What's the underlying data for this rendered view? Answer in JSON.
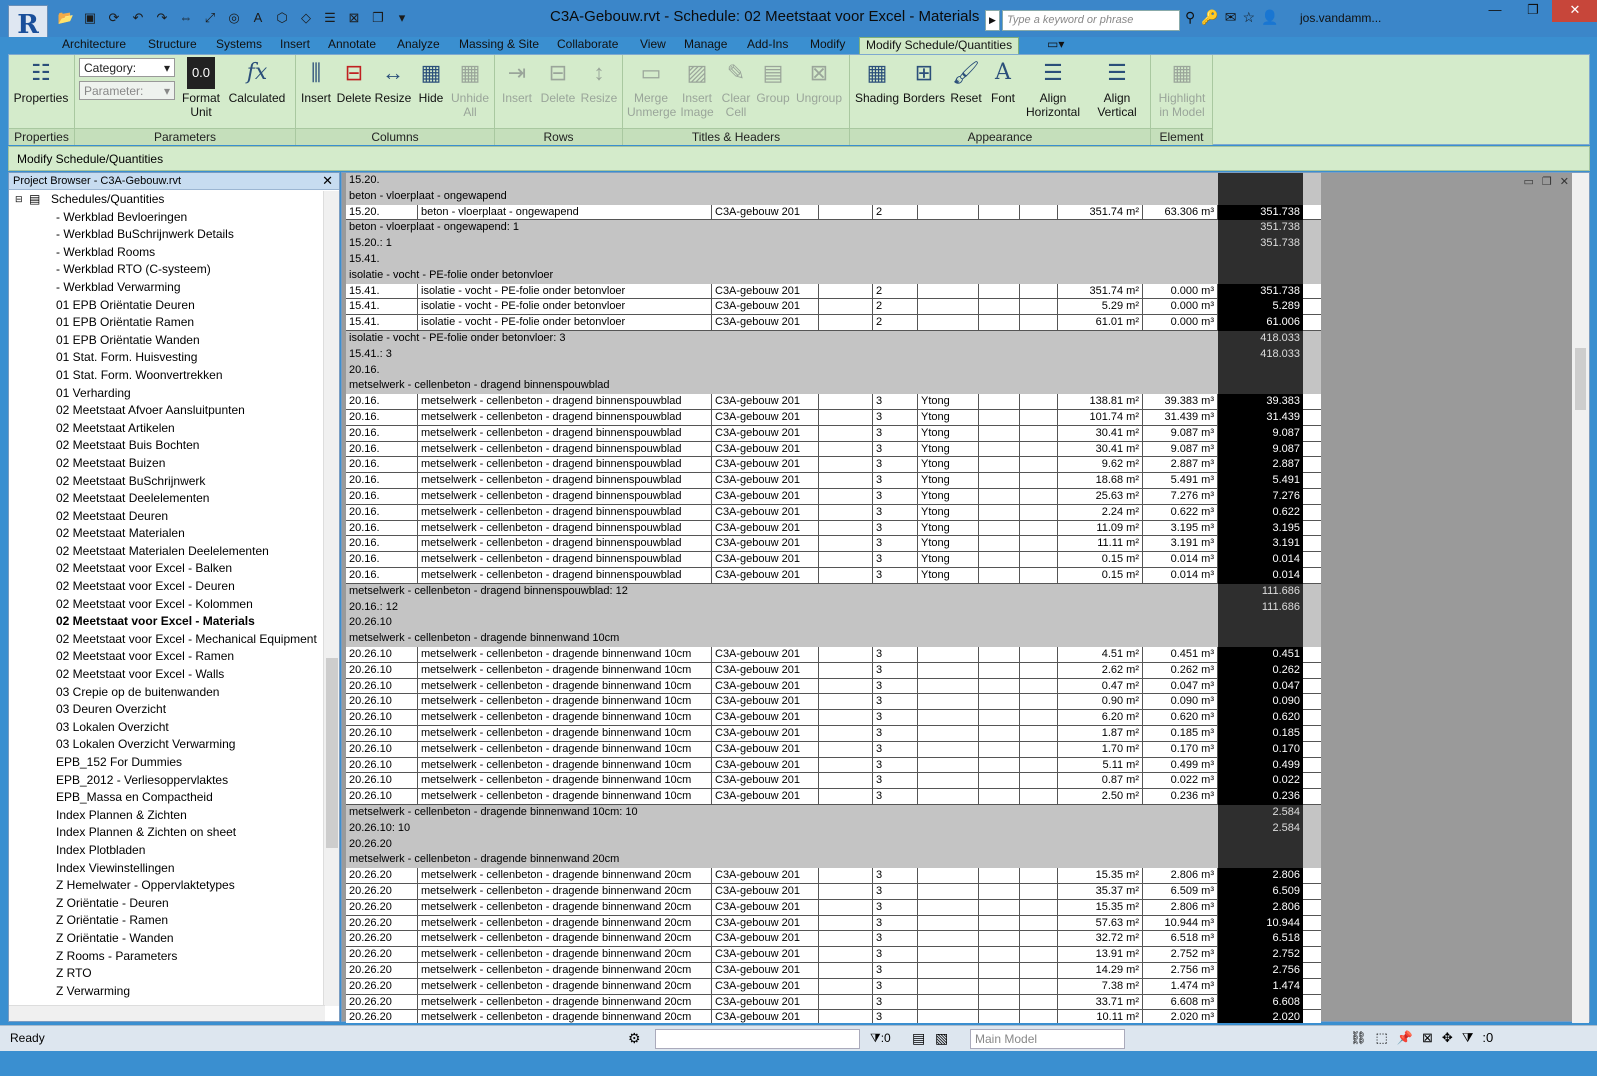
{
  "window": {
    "title": "C3A-Gebouw.rvt - Schedule: 02 Meetstaat voor Excel - Materials",
    "search_placeholder": "Type a keyword or phrase",
    "user": "jos.vandamm...",
    "app_letter": "R"
  },
  "tabs": [
    "Architecture",
    "Structure",
    "Systems",
    "Insert",
    "Annotate",
    "Analyze",
    "Massing & Site",
    "Collaborate",
    "View",
    "Manage",
    "Add-Ins",
    "Modify",
    "Modify Schedule/Quantities"
  ],
  "ribbon": {
    "properties": {
      "label": "Properties",
      "panel": "Properties"
    },
    "parameters": {
      "category": "Category:",
      "parameter": "Parameter:",
      "format_unit": "Format Unit",
      "calculated": "Calculated",
      "panel": "Parameters"
    },
    "columns": {
      "insert": "Insert",
      "delete": "Delete",
      "resize": "Resize",
      "hide": "Hide",
      "unhide": "Unhide All",
      "panel": "Columns"
    },
    "rows": {
      "insert": "Insert",
      "delete": "Delete",
      "resize": "Resize",
      "panel": "Rows"
    },
    "titles": {
      "merge": "Merge Unmerge",
      "insert_image": "Insert Image",
      "clear_cell": "Clear Cell",
      "group": "Group",
      "ungroup": "Ungroup",
      "panel": "Titles & Headers"
    },
    "appearance": {
      "shading": "Shading",
      "borders": "Borders",
      "reset": "Reset",
      "font": "Font",
      "align_h": "Align Horizontal",
      "align_v": "Align Vertical",
      "panel": "Appearance"
    },
    "element": {
      "highlight": "Highlight in Model",
      "panel": "Element"
    }
  },
  "context_bar": "Modify Schedule/Quantities",
  "browser": {
    "title": "Project Browser - C3A-Gebouw.rvt",
    "root": "Schedules/Quantities",
    "items": [
      "- Werkblad Bevloeringen",
      "- Werkblad BuSchrijnwerk Details",
      "- Werkblad Rooms",
      "- Werkblad RTO (C-systeem)",
      "- Werkblad Verwarming",
      "01 EPB Oriëntatie Deuren",
      "01 EPB Oriëntatie Ramen",
      "01 EPB Oriëntatie Wanden",
      "01 Stat. Form. Huisvesting",
      "01 Stat. Form. Woonvertrekken",
      "01 Verharding",
      "02 Meetstaat Afvoer Aansluitpunten",
      "02 Meetstaat Artikelen",
      "02 Meetstaat Buis Bochten",
      "02 Meetstaat Buizen",
      "02 Meetstaat BuSchrijnwerk",
      "02 Meetstaat Deelelementen",
      "02 Meetstaat Deuren",
      "02 Meetstaat Materialen",
      "02 Meetstaat Materialen Deelelementen",
      "02 Meetstaat voor Excel - Balken",
      "02 Meetstaat voor Excel - Deuren",
      "02 Meetstaat voor Excel - Kolommen",
      "02 Meetstaat voor Excel - Materials",
      "02 Meetstaat voor Excel - Mechanical Equipment",
      "02 Meetstaat voor Excel - Ramen",
      "02 Meetstaat voor Excel - Walls",
      "03 Crepie op de buitenwanden",
      "03 Deuren Overzicht",
      "03 Lokalen Overzicht",
      "03 Lokalen Overzicht Verwarming",
      "EPB_152  For Dummies",
      "EPB_2012 - Verliesoppervlaktes",
      "EPB_Massa en Compactheid",
      "Index Plannen & Zichten",
      "Index Plannen & Zichten on sheet",
      "Index Plotbladen",
      "Index Viewinstellingen",
      "Z Hemelwater - Oppervlaktetypes",
      "Z Oriëntatie - Deuren",
      "Z Oriëntatie - Ramen",
      "Z Oriëntatie - Wanden",
      "Z Rooms - Parameters",
      "Z RTO",
      "Z Verwarming"
    ],
    "current": "02 Meetstaat voor Excel - Materials"
  },
  "schedule_rows": [
    {
      "t": "g",
      "a": "15.20."
    },
    {
      "t": "g",
      "a": "beton - vloerplaat - ongewapend"
    },
    {
      "t": "d",
      "a": "15.20.",
      "b": "beton - vloerplaat - ongewapend",
      "c": "C3A-gebouw 201",
      "e": "2",
      "f": "",
      "i": "351.74 m²",
      "j": "63.306 m³",
      "k": "351.738"
    },
    {
      "t": "g",
      "a": "beton - vloerplaat - ongewapend: 1",
      "k": "351.738"
    },
    {
      "t": "g",
      "a": "15.20.: 1",
      "k": "351.738"
    },
    {
      "t": "g",
      "a": "15.41."
    },
    {
      "t": "g",
      "a": "isolatie - vocht - PE-folie onder betonvloer"
    },
    {
      "t": "d",
      "a": "15.41.",
      "b": "isolatie - vocht - PE-folie onder betonvloer",
      "c": "C3A-gebouw 201",
      "e": "2",
      "f": "",
      "i": "351.74 m²",
      "j": "0.000 m³",
      "k": "351.738"
    },
    {
      "t": "d",
      "a": "15.41.",
      "b": "isolatie - vocht - PE-folie onder betonvloer",
      "c": "C3A-gebouw 201",
      "e": "2",
      "f": "",
      "i": "5.29 m²",
      "j": "0.000 m³",
      "k": "5.289"
    },
    {
      "t": "d",
      "a": "15.41.",
      "b": "isolatie - vocht - PE-folie onder betonvloer",
      "c": "C3A-gebouw 201",
      "e": "2",
      "f": "",
      "i": "61.01 m²",
      "j": "0.000 m³",
      "k": "61.006"
    },
    {
      "t": "g",
      "a": "isolatie - vocht - PE-folie onder betonvloer: 3",
      "k": "418.033"
    },
    {
      "t": "g",
      "a": "15.41.: 3",
      "k": "418.033"
    },
    {
      "t": "g",
      "a": "20.16."
    },
    {
      "t": "g",
      "a": "metselwerk - cellenbeton - dragend binnenspouwblad"
    },
    {
      "t": "d",
      "a": "20.16.",
      "b": "metselwerk - cellenbeton - dragend binnenspouwblad",
      "c": "C3A-gebouw 201",
      "e": "3",
      "f": "Ytong",
      "i": "138.81 m²",
      "j": "39.383 m³",
      "k": "39.383"
    },
    {
      "t": "d",
      "a": "20.16.",
      "b": "metselwerk - cellenbeton - dragend binnenspouwblad",
      "c": "C3A-gebouw 201",
      "e": "3",
      "f": "Ytong",
      "i": "101.74 m²",
      "j": "31.439 m³",
      "k": "31.439"
    },
    {
      "t": "d",
      "a": "20.16.",
      "b": "metselwerk - cellenbeton - dragend binnenspouwblad",
      "c": "C3A-gebouw 201",
      "e": "3",
      "f": "Ytong",
      "i": "30.41 m²",
      "j": "9.087 m³",
      "k": "9.087"
    },
    {
      "t": "d",
      "a": "20.16.",
      "b": "metselwerk - cellenbeton - dragend binnenspouwblad",
      "c": "C3A-gebouw 201",
      "e": "3",
      "f": "Ytong",
      "i": "30.41 m²",
      "j": "9.087 m³",
      "k": "9.087"
    },
    {
      "t": "d",
      "a": "20.16.",
      "b": "metselwerk - cellenbeton - dragend binnenspouwblad",
      "c": "C3A-gebouw 201",
      "e": "3",
      "f": "Ytong",
      "i": "9.62 m²",
      "j": "2.887 m³",
      "k": "2.887"
    },
    {
      "t": "d",
      "a": "20.16.",
      "b": "metselwerk - cellenbeton - dragend binnenspouwblad",
      "c": "C3A-gebouw 201",
      "e": "3",
      "f": "Ytong",
      "i": "18.68 m²",
      "j": "5.491 m³",
      "k": "5.491"
    },
    {
      "t": "d",
      "a": "20.16.",
      "b": "metselwerk - cellenbeton - dragend binnenspouwblad",
      "c": "C3A-gebouw 201",
      "e": "3",
      "f": "Ytong",
      "i": "25.63 m²",
      "j": "7.276 m³",
      "k": "7.276"
    },
    {
      "t": "d",
      "a": "20.16.",
      "b": "metselwerk - cellenbeton - dragend binnenspouwblad",
      "c": "C3A-gebouw 201",
      "e": "3",
      "f": "Ytong",
      "i": "2.24 m²",
      "j": "0.622 m³",
      "k": "0.622"
    },
    {
      "t": "d",
      "a": "20.16.",
      "b": "metselwerk - cellenbeton - dragend binnenspouwblad",
      "c": "C3A-gebouw 201",
      "e": "3",
      "f": "Ytong",
      "i": "11.09 m²",
      "j": "3.195 m³",
      "k": "3.195"
    },
    {
      "t": "d",
      "a": "20.16.",
      "b": "metselwerk - cellenbeton - dragend binnenspouwblad",
      "c": "C3A-gebouw 201",
      "e": "3",
      "f": "Ytong",
      "i": "11.11 m²",
      "j": "3.191 m³",
      "k": "3.191"
    },
    {
      "t": "d",
      "a": "20.16.",
      "b": "metselwerk - cellenbeton - dragend binnenspouwblad",
      "c": "C3A-gebouw 201",
      "e": "3",
      "f": "Ytong",
      "i": "0.15 m²",
      "j": "0.014 m³",
      "k": "0.014"
    },
    {
      "t": "d",
      "a": "20.16.",
      "b": "metselwerk - cellenbeton - dragend binnenspouwblad",
      "c": "C3A-gebouw 201",
      "e": "3",
      "f": "Ytong",
      "i": "0.15 m²",
      "j": "0.014 m³",
      "k": "0.014"
    },
    {
      "t": "g",
      "a": "metselwerk - cellenbeton - dragend binnenspouwblad: 12",
      "k": "111.686"
    },
    {
      "t": "g",
      "a": "20.16.: 12",
      "k": "111.686"
    },
    {
      "t": "g",
      "a": "20.26.10"
    },
    {
      "t": "g",
      "a": "metselwerk - cellenbeton - dragende binnenwand 10cm"
    },
    {
      "t": "d",
      "a": "20.26.10",
      "b": "metselwerk - cellenbeton - dragende binnenwand 10cm",
      "c": "C3A-gebouw 201",
      "e": "3",
      "f": "",
      "i": "4.51 m²",
      "j": "0.451 m³",
      "k": "0.451"
    },
    {
      "t": "d",
      "a": "20.26.10",
      "b": "metselwerk - cellenbeton - dragende binnenwand 10cm",
      "c": "C3A-gebouw 201",
      "e": "3",
      "f": "",
      "i": "2.62 m²",
      "j": "0.262 m³",
      "k": "0.262"
    },
    {
      "t": "d",
      "a": "20.26.10",
      "b": "metselwerk - cellenbeton - dragende binnenwand 10cm",
      "c": "C3A-gebouw 201",
      "e": "3",
      "f": "",
      "i": "0.47 m²",
      "j": "0.047 m³",
      "k": "0.047"
    },
    {
      "t": "d",
      "a": "20.26.10",
      "b": "metselwerk - cellenbeton - dragende binnenwand 10cm",
      "c": "C3A-gebouw 201",
      "e": "3",
      "f": "",
      "i": "0.90 m²",
      "j": "0.090 m³",
      "k": "0.090"
    },
    {
      "t": "d",
      "a": "20.26.10",
      "b": "metselwerk - cellenbeton - dragende binnenwand 10cm",
      "c": "C3A-gebouw 201",
      "e": "3",
      "f": "",
      "i": "6.20 m²",
      "j": "0.620 m³",
      "k": "0.620"
    },
    {
      "t": "d",
      "a": "20.26.10",
      "b": "metselwerk - cellenbeton - dragende binnenwand 10cm",
      "c": "C3A-gebouw 201",
      "e": "3",
      "f": "",
      "i": "1.87 m²",
      "j": "0.185 m³",
      "k": "0.185"
    },
    {
      "t": "d",
      "a": "20.26.10",
      "b": "metselwerk - cellenbeton - dragende binnenwand 10cm",
      "c": "C3A-gebouw 201",
      "e": "3",
      "f": "",
      "i": "1.70 m²",
      "j": "0.170 m³",
      "k": "0.170"
    },
    {
      "t": "d",
      "a": "20.26.10",
      "b": "metselwerk - cellenbeton - dragende binnenwand 10cm",
      "c": "C3A-gebouw 201",
      "e": "3",
      "f": "",
      "i": "5.11 m²",
      "j": "0.499 m³",
      "k": "0.499"
    },
    {
      "t": "d",
      "a": "20.26.10",
      "b": "metselwerk - cellenbeton - dragende binnenwand 10cm",
      "c": "C3A-gebouw 201",
      "e": "3",
      "f": "",
      "i": "0.87 m²",
      "j": "0.022 m³",
      "k": "0.022"
    },
    {
      "t": "d",
      "a": "20.26.10",
      "b": "metselwerk - cellenbeton - dragende binnenwand 10cm",
      "c": "C3A-gebouw 201",
      "e": "3",
      "f": "",
      "i": "2.50 m²",
      "j": "0.236 m³",
      "k": "0.236"
    },
    {
      "t": "g",
      "a": "metselwerk - cellenbeton - dragende binnenwand 10cm: 10",
      "k": "2.584"
    },
    {
      "t": "g",
      "a": "20.26.10: 10",
      "k": "2.584"
    },
    {
      "t": "g",
      "a": "20.26.20"
    },
    {
      "t": "g",
      "a": "metselwerk - cellenbeton - dragende binnenwand 20cm"
    },
    {
      "t": "d",
      "a": "20.26.20",
      "b": "metselwerk - cellenbeton - dragende binnenwand 20cm",
      "c": "C3A-gebouw 201",
      "e": "3",
      "f": "",
      "i": "15.35 m²",
      "j": "2.806 m³",
      "k": "2.806"
    },
    {
      "t": "d",
      "a": "20.26.20",
      "b": "metselwerk - cellenbeton - dragende binnenwand 20cm",
      "c": "C3A-gebouw 201",
      "e": "3",
      "f": "",
      "i": "35.37 m²",
      "j": "6.509 m³",
      "k": "6.509"
    },
    {
      "t": "d",
      "a": "20.26.20",
      "b": "metselwerk - cellenbeton - dragende binnenwand 20cm",
      "c": "C3A-gebouw 201",
      "e": "3",
      "f": "",
      "i": "15.35 m²",
      "j": "2.806 m³",
      "k": "2.806"
    },
    {
      "t": "d",
      "a": "20.26.20",
      "b": "metselwerk - cellenbeton - dragende binnenwand 20cm",
      "c": "C3A-gebouw 201",
      "e": "3",
      "f": "",
      "i": "57.63 m²",
      "j": "10.944 m³",
      "k": "10.944"
    },
    {
      "t": "d",
      "a": "20.26.20",
      "b": "metselwerk - cellenbeton - dragende binnenwand 20cm",
      "c": "C3A-gebouw 201",
      "e": "3",
      "f": "",
      "i": "32.72 m²",
      "j": "6.518 m³",
      "k": "6.518"
    },
    {
      "t": "d",
      "a": "20.26.20",
      "b": "metselwerk - cellenbeton - dragende binnenwand 20cm",
      "c": "C3A-gebouw 201",
      "e": "3",
      "f": "",
      "i": "13.91 m²",
      "j": "2.752 m³",
      "k": "2.752"
    },
    {
      "t": "d",
      "a": "20.26.20",
      "b": "metselwerk - cellenbeton - dragende binnenwand 20cm",
      "c": "C3A-gebouw 201",
      "e": "3",
      "f": "",
      "i": "14.29 m²",
      "j": "2.756 m³",
      "k": "2.756"
    },
    {
      "t": "d",
      "a": "20.26.20",
      "b": "metselwerk - cellenbeton - dragende binnenwand 20cm",
      "c": "C3A-gebouw 201",
      "e": "3",
      "f": "",
      "i": "7.38 m²",
      "j": "1.474 m³",
      "k": "1.474"
    },
    {
      "t": "d",
      "a": "20.26.20",
      "b": "metselwerk - cellenbeton - dragende binnenwand 20cm",
      "c": "C3A-gebouw 201",
      "e": "3",
      "f": "",
      "i": "33.71 m²",
      "j": "6.608 m³",
      "k": "6.608"
    },
    {
      "t": "d",
      "a": "20.26.20",
      "b": "metselwerk - cellenbeton - dragende binnenwand 20cm",
      "c": "C3A-gebouw 201",
      "e": "3",
      "f": "",
      "i": "10.11 m²",
      "j": "2.020 m³",
      "k": "2.020"
    }
  ],
  "status": {
    "ready": "Ready",
    "filter_count": ":0",
    "model": "Main Model",
    "selection_count": ":0"
  }
}
